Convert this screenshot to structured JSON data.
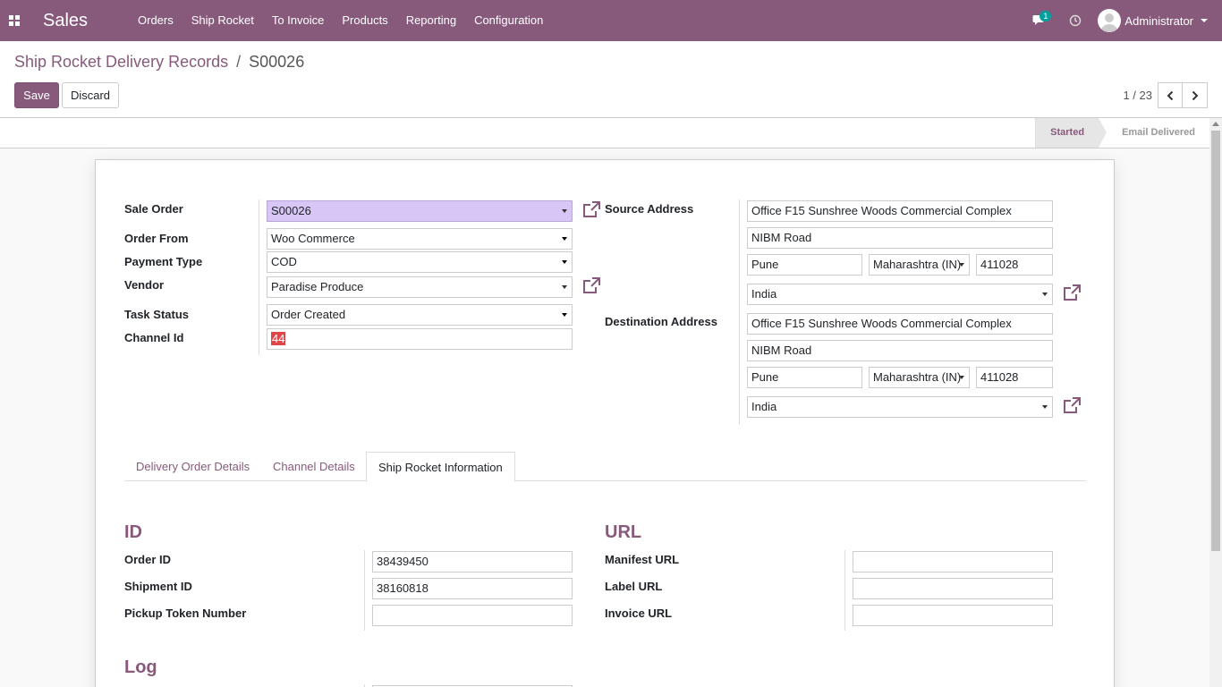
{
  "navbar": {
    "app_name": "Sales",
    "menu": [
      "Orders",
      "Ship Rocket",
      "To Invoice",
      "Products",
      "Reporting",
      "Configuration"
    ],
    "chat_badge": "1",
    "user": "Administrator",
    "accent": "#875a7b"
  },
  "breadcrumb": {
    "parent": "Ship Rocket Delivery Records",
    "separator": "/",
    "current": "S00026"
  },
  "buttons": {
    "save": "Save",
    "discard": "Discard"
  },
  "pager": {
    "value": "1 / 23"
  },
  "statusbar": {
    "steps": [
      "Started",
      "Email Delivered"
    ],
    "active": "Started"
  },
  "form": {
    "left": {
      "sale_order_label": "Sale Order",
      "sale_order": "S00026",
      "order_from_label": "Order From",
      "order_from": "Woo Commerce",
      "payment_type_label": "Payment Type",
      "payment_type": "COD",
      "vendor_label": "Vendor",
      "vendor": "Paradise Produce",
      "task_status_label": "Task Status",
      "task_status": "Order Created",
      "channel_id_label": "Channel Id",
      "channel_id": "44"
    },
    "source": {
      "label": "Source Address",
      "street": "Office F15 Sunshree Woods Commercial Complex",
      "street2": "NIBM Road",
      "city": "Pune",
      "state": "Maharashtra (IN)",
      "zip": "411028",
      "country": "India"
    },
    "destination": {
      "label": "Destination Address",
      "street": "Office F15 Sunshree Woods Commercial Complex",
      "street2": "NIBM Road",
      "city": "Pune",
      "state": "Maharashtra (IN)",
      "zip": "411028",
      "country": "India"
    }
  },
  "tabs": [
    "Delivery Order Details",
    "Channel Details",
    "Ship Rocket Information"
  ],
  "active_tab": "Ship Rocket Information",
  "id_section": {
    "title": "ID",
    "order_id_label": "Order ID",
    "order_id": "38439450",
    "shipment_id_label": "Shipment ID",
    "shipment_id": "38160818",
    "pickup_token_label": "Pickup Token Number",
    "pickup_token": ""
  },
  "url_section": {
    "title": "URL",
    "manifest_label": "Manifest URL",
    "manifest": "",
    "label_url_label": "Label URL",
    "label_url": "",
    "invoice_label": "Invoice URL",
    "invoice": ""
  },
  "log_section": {
    "title": "Log"
  }
}
